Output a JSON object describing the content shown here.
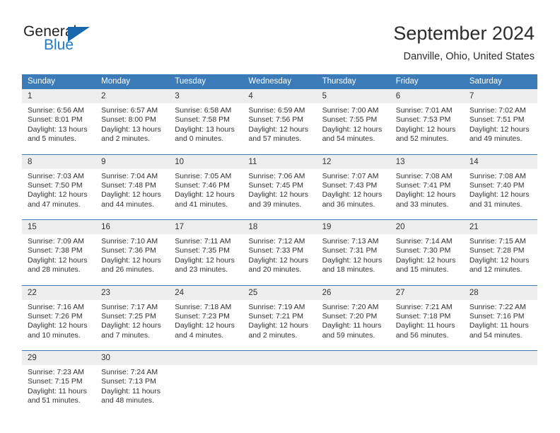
{
  "brand": {
    "name_top": "General",
    "name_bottom": "Blue",
    "color_dark": "#231f20",
    "color_blue": "#1f7bc1",
    "triangle_color": "#1767ac"
  },
  "header": {
    "title": "September 2024",
    "location": "Danville, Ohio, United States"
  },
  "theme": {
    "header_row_bg": "#3b7cb8",
    "header_row_text": "#ffffff",
    "daynum_band_bg": "#eeeeee",
    "grid_line": "#3b7cb8",
    "body_text": "#303030"
  },
  "weekday_headers": [
    "Sunday",
    "Monday",
    "Tuesday",
    "Wednesday",
    "Thursday",
    "Friday",
    "Saturday"
  ],
  "weeks": [
    [
      {
        "day": "1",
        "sunrise": "Sunrise: 6:56 AM",
        "sunset": "Sunset: 8:01 PM",
        "daylight1": "Daylight: 13 hours",
        "daylight2": "and 5 minutes."
      },
      {
        "day": "2",
        "sunrise": "Sunrise: 6:57 AM",
        "sunset": "Sunset: 8:00 PM",
        "daylight1": "Daylight: 13 hours",
        "daylight2": "and 2 minutes."
      },
      {
        "day": "3",
        "sunrise": "Sunrise: 6:58 AM",
        "sunset": "Sunset: 7:58 PM",
        "daylight1": "Daylight: 13 hours",
        "daylight2": "and 0 minutes."
      },
      {
        "day": "4",
        "sunrise": "Sunrise: 6:59 AM",
        "sunset": "Sunset: 7:56 PM",
        "daylight1": "Daylight: 12 hours",
        "daylight2": "and 57 minutes."
      },
      {
        "day": "5",
        "sunrise": "Sunrise: 7:00 AM",
        "sunset": "Sunset: 7:55 PM",
        "daylight1": "Daylight: 12 hours",
        "daylight2": "and 54 minutes."
      },
      {
        "day": "6",
        "sunrise": "Sunrise: 7:01 AM",
        "sunset": "Sunset: 7:53 PM",
        "daylight1": "Daylight: 12 hours",
        "daylight2": "and 52 minutes."
      },
      {
        "day": "7",
        "sunrise": "Sunrise: 7:02 AM",
        "sunset": "Sunset: 7:51 PM",
        "daylight1": "Daylight: 12 hours",
        "daylight2": "and 49 minutes."
      }
    ],
    [
      {
        "day": "8",
        "sunrise": "Sunrise: 7:03 AM",
        "sunset": "Sunset: 7:50 PM",
        "daylight1": "Daylight: 12 hours",
        "daylight2": "and 47 minutes."
      },
      {
        "day": "9",
        "sunrise": "Sunrise: 7:04 AM",
        "sunset": "Sunset: 7:48 PM",
        "daylight1": "Daylight: 12 hours",
        "daylight2": "and 44 minutes."
      },
      {
        "day": "10",
        "sunrise": "Sunrise: 7:05 AM",
        "sunset": "Sunset: 7:46 PM",
        "daylight1": "Daylight: 12 hours",
        "daylight2": "and 41 minutes."
      },
      {
        "day": "11",
        "sunrise": "Sunrise: 7:06 AM",
        "sunset": "Sunset: 7:45 PM",
        "daylight1": "Daylight: 12 hours",
        "daylight2": "and 39 minutes."
      },
      {
        "day": "12",
        "sunrise": "Sunrise: 7:07 AM",
        "sunset": "Sunset: 7:43 PM",
        "daylight1": "Daylight: 12 hours",
        "daylight2": "and 36 minutes."
      },
      {
        "day": "13",
        "sunrise": "Sunrise: 7:08 AM",
        "sunset": "Sunset: 7:41 PM",
        "daylight1": "Daylight: 12 hours",
        "daylight2": "and 33 minutes."
      },
      {
        "day": "14",
        "sunrise": "Sunrise: 7:08 AM",
        "sunset": "Sunset: 7:40 PM",
        "daylight1": "Daylight: 12 hours",
        "daylight2": "and 31 minutes."
      }
    ],
    [
      {
        "day": "15",
        "sunrise": "Sunrise: 7:09 AM",
        "sunset": "Sunset: 7:38 PM",
        "daylight1": "Daylight: 12 hours",
        "daylight2": "and 28 minutes."
      },
      {
        "day": "16",
        "sunrise": "Sunrise: 7:10 AM",
        "sunset": "Sunset: 7:36 PM",
        "daylight1": "Daylight: 12 hours",
        "daylight2": "and 26 minutes."
      },
      {
        "day": "17",
        "sunrise": "Sunrise: 7:11 AM",
        "sunset": "Sunset: 7:35 PM",
        "daylight1": "Daylight: 12 hours",
        "daylight2": "and 23 minutes."
      },
      {
        "day": "18",
        "sunrise": "Sunrise: 7:12 AM",
        "sunset": "Sunset: 7:33 PM",
        "daylight1": "Daylight: 12 hours",
        "daylight2": "and 20 minutes."
      },
      {
        "day": "19",
        "sunrise": "Sunrise: 7:13 AM",
        "sunset": "Sunset: 7:31 PM",
        "daylight1": "Daylight: 12 hours",
        "daylight2": "and 18 minutes."
      },
      {
        "day": "20",
        "sunrise": "Sunrise: 7:14 AM",
        "sunset": "Sunset: 7:30 PM",
        "daylight1": "Daylight: 12 hours",
        "daylight2": "and 15 minutes."
      },
      {
        "day": "21",
        "sunrise": "Sunrise: 7:15 AM",
        "sunset": "Sunset: 7:28 PM",
        "daylight1": "Daylight: 12 hours",
        "daylight2": "and 12 minutes."
      }
    ],
    [
      {
        "day": "22",
        "sunrise": "Sunrise: 7:16 AM",
        "sunset": "Sunset: 7:26 PM",
        "daylight1": "Daylight: 12 hours",
        "daylight2": "and 10 minutes."
      },
      {
        "day": "23",
        "sunrise": "Sunrise: 7:17 AM",
        "sunset": "Sunset: 7:25 PM",
        "daylight1": "Daylight: 12 hours",
        "daylight2": "and 7 minutes."
      },
      {
        "day": "24",
        "sunrise": "Sunrise: 7:18 AM",
        "sunset": "Sunset: 7:23 PM",
        "daylight1": "Daylight: 12 hours",
        "daylight2": "and 4 minutes."
      },
      {
        "day": "25",
        "sunrise": "Sunrise: 7:19 AM",
        "sunset": "Sunset: 7:21 PM",
        "daylight1": "Daylight: 12 hours",
        "daylight2": "and 2 minutes."
      },
      {
        "day": "26",
        "sunrise": "Sunrise: 7:20 AM",
        "sunset": "Sunset: 7:20 PM",
        "daylight1": "Daylight: 11 hours",
        "daylight2": "and 59 minutes."
      },
      {
        "day": "27",
        "sunrise": "Sunrise: 7:21 AM",
        "sunset": "Sunset: 7:18 PM",
        "daylight1": "Daylight: 11 hours",
        "daylight2": "and 56 minutes."
      },
      {
        "day": "28",
        "sunrise": "Sunrise: 7:22 AM",
        "sunset": "Sunset: 7:16 PM",
        "daylight1": "Daylight: 11 hours",
        "daylight2": "and 54 minutes."
      }
    ],
    [
      {
        "day": "29",
        "sunrise": "Sunrise: 7:23 AM",
        "sunset": "Sunset: 7:15 PM",
        "daylight1": "Daylight: 11 hours",
        "daylight2": "and 51 minutes."
      },
      {
        "day": "30",
        "sunrise": "Sunrise: 7:24 AM",
        "sunset": "Sunset: 7:13 PM",
        "daylight1": "Daylight: 11 hours",
        "daylight2": "and 48 minutes."
      },
      {
        "day": "",
        "sunrise": "",
        "sunset": "",
        "daylight1": "",
        "daylight2": ""
      },
      {
        "day": "",
        "sunrise": "",
        "sunset": "",
        "daylight1": "",
        "daylight2": ""
      },
      {
        "day": "",
        "sunrise": "",
        "sunset": "",
        "daylight1": "",
        "daylight2": ""
      },
      {
        "day": "",
        "sunrise": "",
        "sunset": "",
        "daylight1": "",
        "daylight2": ""
      },
      {
        "day": "",
        "sunrise": "",
        "sunset": "",
        "daylight1": "",
        "daylight2": ""
      }
    ]
  ]
}
